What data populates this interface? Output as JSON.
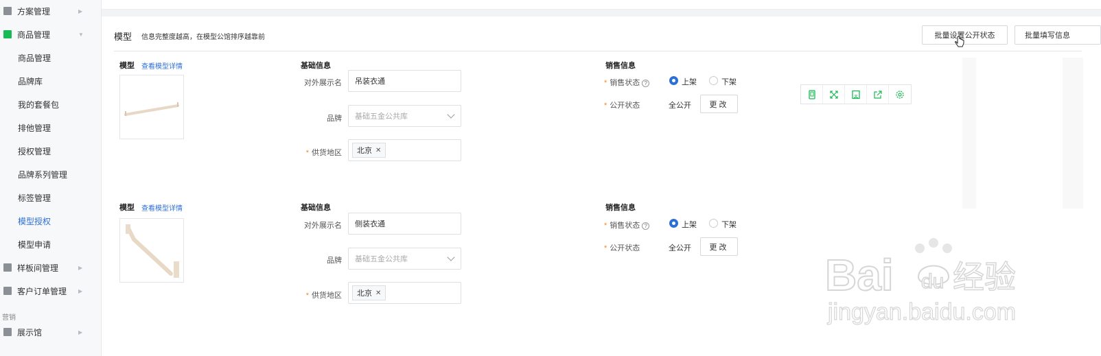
{
  "sidebar": {
    "items": [
      {
        "label": "方案管理",
        "icon": "folder-icon"
      },
      {
        "label": "商品管理",
        "icon": "bag-icon"
      }
    ],
    "sub_items": [
      {
        "label": "商品管理"
      },
      {
        "label": "品牌库"
      },
      {
        "label": "我的套餐包"
      },
      {
        "label": "排他管理"
      },
      {
        "label": "授权管理"
      },
      {
        "label": "品牌系列管理"
      },
      {
        "label": "标签管理"
      },
      {
        "label": "模型授权",
        "active": true
      },
      {
        "label": "模型申请"
      }
    ],
    "bottom_items": [
      {
        "label": "样板间管理",
        "icon": "box-icon"
      },
      {
        "label": "客户订单管理",
        "icon": "order-icon"
      }
    ],
    "group_label": "营销",
    "group_items": [
      {
        "label": "展示馆",
        "icon": "gallery-icon"
      }
    ]
  },
  "header": {
    "title": "模型",
    "hint": "信息完整度越高，在模型公馆排序越靠前",
    "batch_public_button": "批量设置公开状态",
    "batch_fill_button": "批量填写信息"
  },
  "models": [
    {
      "section_label": "模型",
      "detail_link": "查看模型详情",
      "basic_title": "基础信息",
      "display_name_label": "对外展示名",
      "display_name_value": "吊装衣通",
      "brand_label": "品牌",
      "brand_value": "基础五金公共库",
      "region_label": "供货地区",
      "region_tag": "北京",
      "sales_title": "销售信息",
      "sale_status_label": "销售状态",
      "on_label": "上架",
      "off_label": "下架",
      "public_status_label": "公开状态",
      "public_status_value": "全公开",
      "change_button": "更改"
    },
    {
      "section_label": "模型",
      "detail_link": "查看模型详情",
      "basic_title": "基础信息",
      "display_name_label": "对外展示名",
      "display_name_value": "侧装衣通",
      "brand_label": "品牌",
      "brand_value": "基础五金公共库",
      "region_label": "供货地区",
      "region_tag": "北京",
      "sales_title": "销售信息",
      "sale_status_label": "销售状态",
      "on_label": "上架",
      "off_label": "下架",
      "public_status_label": "公开状态",
      "public_status_value": "全公开",
      "change_button": "更改"
    }
  ],
  "toolbar": [
    "tablet-icon",
    "expand-icon",
    "save-icon",
    "share-icon",
    "settings-icon"
  ],
  "watermark": {
    "brand": "Bai",
    "brand2": "du",
    "suffix": "经验",
    "url": "jingyan.baidu.com"
  },
  "colors": {
    "accent": "#2d6fd8",
    "required": "#f08a24",
    "brand_green": "#19b955"
  }
}
